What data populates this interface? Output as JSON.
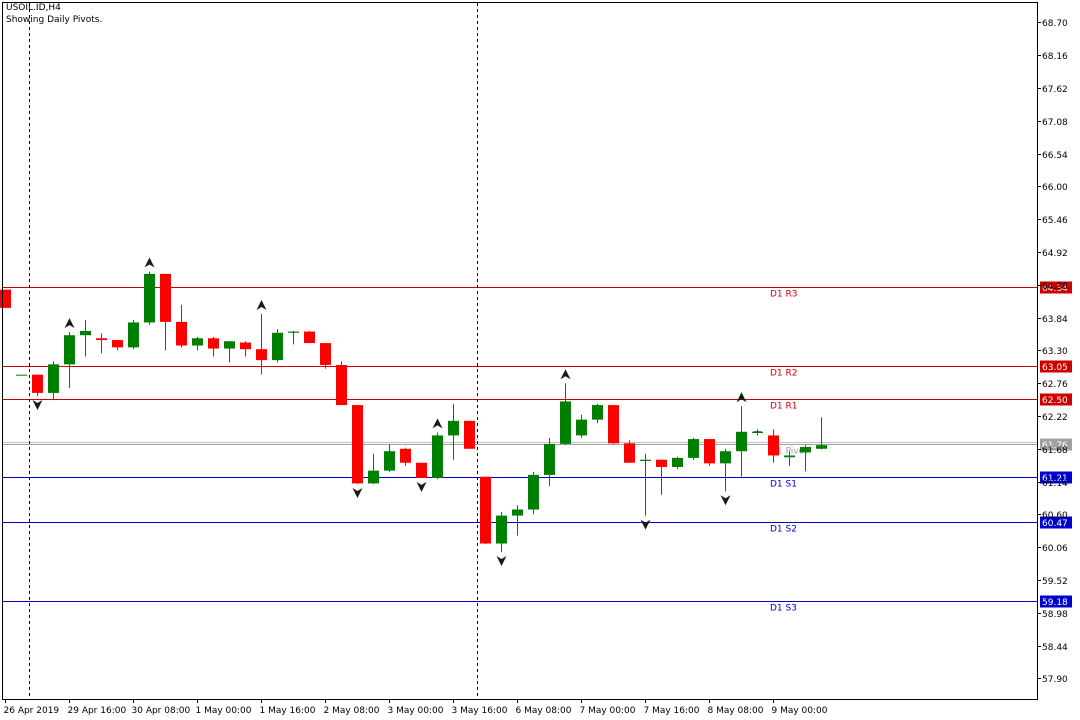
{
  "header": {
    "symbol_line": "USOIL.ID,H4",
    "note_line": "Showing Daily Pivots."
  },
  "colors": {
    "bull": "#008000",
    "bear": "#ff0000",
    "resistance": "#cc0000",
    "support": "#0000cc",
    "pivot": "#a0a0a0",
    "axis": "#000000",
    "price_tag": "#7f7f7f"
  },
  "chart_data": {
    "type": "candlestick",
    "title": "USOIL.ID,H4",
    "xlabel": "",
    "ylabel": "",
    "ylim": [
      57.56,
      69.02
    ],
    "grid": false,
    "y_ticks": [
      "68.70",
      "68.16",
      "67.62",
      "67.08",
      "66.54",
      "66.00",
      "65.46",
      "64.92",
      "64.38",
      "63.84",
      "63.30",
      "62.76",
      "62.22",
      "61.68",
      "61.14",
      "60.60",
      "60.06",
      "59.52",
      "58.98",
      "58.44",
      "57.90"
    ],
    "x_tick_labels": [
      "26 Apr 2019",
      "29 Apr 16:00",
      "30 Apr 08:00",
      "1 May 00:00",
      "1 May 16:00",
      "2 May 08:00",
      "3 May 00:00",
      "3 May 16:00",
      "6 May 08:00",
      "7 May 00:00",
      "7 May 16:00",
      "8 May 08:00",
      "9 May 00:00"
    ],
    "pivot_levels": [
      {
        "label": "D1 R3",
        "value": 64.34,
        "tag": "64.34",
        "kind": "resistance"
      },
      {
        "label": "D1 R2",
        "value": 63.05,
        "tag": "63.05",
        "kind": "resistance"
      },
      {
        "label": "D1 R1",
        "value": 62.5,
        "tag": "62.50",
        "kind": "resistance"
      },
      {
        "label": "D1 Pivot",
        "value": 61.76,
        "tag": "61.76",
        "kind": "pivot"
      },
      {
        "label": "D1 S1",
        "value": 61.21,
        "tag": "61.21",
        "kind": "support"
      },
      {
        "label": "D1 S2",
        "value": 60.47,
        "tag": "60.47",
        "kind": "support"
      },
      {
        "label": "D1 S3",
        "value": 59.18,
        "tag": "59.18",
        "kind": "support"
      }
    ],
    "candles": [
      {
        "o": 64.3,
        "h": 64.3,
        "l": 64.0,
        "c": 64.0
      },
      {
        "o": 62.9,
        "h": 62.9,
        "l": 62.9,
        "c": 62.9
      },
      {
        "o": 62.9,
        "h": 62.9,
        "l": 62.55,
        "c": 62.6
      },
      {
        "o": 62.6,
        "h": 63.12,
        "l": 62.48,
        "c": 63.07
      },
      {
        "o": 63.07,
        "h": 63.6,
        "l": 62.68,
        "c": 63.55
      },
      {
        "o": 63.55,
        "h": 63.8,
        "l": 63.2,
        "c": 63.62
      },
      {
        "o": 63.5,
        "h": 63.58,
        "l": 63.25,
        "c": 63.47
      },
      {
        "o": 63.47,
        "h": 63.47,
        "l": 63.3,
        "c": 63.35
      },
      {
        "o": 63.35,
        "h": 63.8,
        "l": 63.32,
        "c": 63.76
      },
      {
        "o": 63.76,
        "h": 64.6,
        "l": 63.72,
        "c": 64.56
      },
      {
        "o": 64.56,
        "h": 64.56,
        "l": 63.3,
        "c": 63.77
      },
      {
        "o": 63.77,
        "h": 64.05,
        "l": 63.35,
        "c": 63.38
      },
      {
        "o": 63.38,
        "h": 63.52,
        "l": 63.3,
        "c": 63.5
      },
      {
        "o": 63.5,
        "h": 63.52,
        "l": 63.2,
        "c": 63.33
      },
      {
        "o": 63.33,
        "h": 63.45,
        "l": 63.1,
        "c": 63.45
      },
      {
        "o": 63.43,
        "h": 63.45,
        "l": 63.2,
        "c": 63.32
      },
      {
        "o": 63.32,
        "h": 63.9,
        "l": 62.9,
        "c": 63.14
      },
      {
        "o": 63.14,
        "h": 63.65,
        "l": 63.1,
        "c": 63.59
      },
      {
        "o": 63.59,
        "h": 63.62,
        "l": 63.4,
        "c": 63.61
      },
      {
        "o": 63.61,
        "h": 63.62,
        "l": 63.43,
        "c": 63.42
      },
      {
        "o": 63.42,
        "h": 63.42,
        "l": 63.0,
        "c": 63.06
      },
      {
        "o": 63.06,
        "h": 63.12,
        "l": 62.4,
        "c": 62.4
      },
      {
        "o": 62.4,
        "h": 62.4,
        "l": 61.1,
        "c": 61.11
      },
      {
        "o": 61.11,
        "h": 61.6,
        "l": 61.1,
        "c": 61.32
      },
      {
        "o": 61.32,
        "h": 61.75,
        "l": 61.3,
        "c": 61.64
      },
      {
        "o": 61.68,
        "h": 61.7,
        "l": 61.4,
        "c": 61.45
      },
      {
        "o": 61.45,
        "h": 61.45,
        "l": 61.2,
        "c": 61.2
      },
      {
        "o": 61.2,
        "h": 61.95,
        "l": 61.18,
        "c": 61.9
      },
      {
        "o": 61.9,
        "h": 62.42,
        "l": 61.5,
        "c": 62.14
      },
      {
        "o": 62.14,
        "h": 62.14,
        "l": 61.68,
        "c": 61.68
      },
      {
        "o": 61.22,
        "h": 61.22,
        "l": 60.11,
        "c": 60.12
      },
      {
        "o": 60.12,
        "h": 60.64,
        "l": 59.98,
        "c": 60.58
      },
      {
        "o": 60.58,
        "h": 60.75,
        "l": 60.25,
        "c": 60.68
      },
      {
        "o": 60.68,
        "h": 61.3,
        "l": 60.6,
        "c": 61.25
      },
      {
        "o": 61.25,
        "h": 61.86,
        "l": 61.07,
        "c": 61.76
      },
      {
        "o": 61.76,
        "h": 62.76,
        "l": 61.74,
        "c": 62.46
      },
      {
        "o": 61.9,
        "h": 62.24,
        "l": 61.86,
        "c": 62.16
      },
      {
        "o": 62.16,
        "h": 62.42,
        "l": 62.1,
        "c": 62.4
      },
      {
        "o": 62.4,
        "h": 62.4,
        "l": 61.76,
        "c": 61.77
      },
      {
        "o": 61.77,
        "h": 61.82,
        "l": 61.45,
        "c": 61.45
      },
      {
        "o": 61.48,
        "h": 61.6,
        "l": 60.58,
        "c": 61.5
      },
      {
        "o": 61.5,
        "h": 61.5,
        "l": 60.92,
        "c": 61.38
      },
      {
        "o": 61.38,
        "h": 61.55,
        "l": 61.35,
        "c": 61.53
      },
      {
        "o": 61.53,
        "h": 61.86,
        "l": 61.5,
        "c": 61.84
      },
      {
        "o": 61.84,
        "h": 61.84,
        "l": 61.4,
        "c": 61.44
      },
      {
        "o": 61.44,
        "h": 61.68,
        "l": 60.98,
        "c": 61.64
      },
      {
        "o": 61.64,
        "h": 62.38,
        "l": 61.22,
        "c": 61.96
      },
      {
        "o": 61.94,
        "h": 62.0,
        "l": 61.9,
        "c": 61.96
      },
      {
        "o": 61.9,
        "h": 62.0,
        "l": 61.45,
        "c": 61.57
      },
      {
        "o": 61.54,
        "h": 61.64,
        "l": 61.4,
        "c": 61.57
      },
      {
        "o": 61.62,
        "h": 61.74,
        "l": 61.31,
        "c": 61.71
      },
      {
        "o": 61.68,
        "h": 62.2,
        "l": 61.67,
        "c": 61.74
      }
    ],
    "fractals_up": [
      4,
      9,
      16,
      27,
      35,
      46
    ],
    "fractals_down": [
      2,
      22,
      26,
      31,
      40,
      45
    ],
    "separators": [
      1,
      29
    ]
  }
}
